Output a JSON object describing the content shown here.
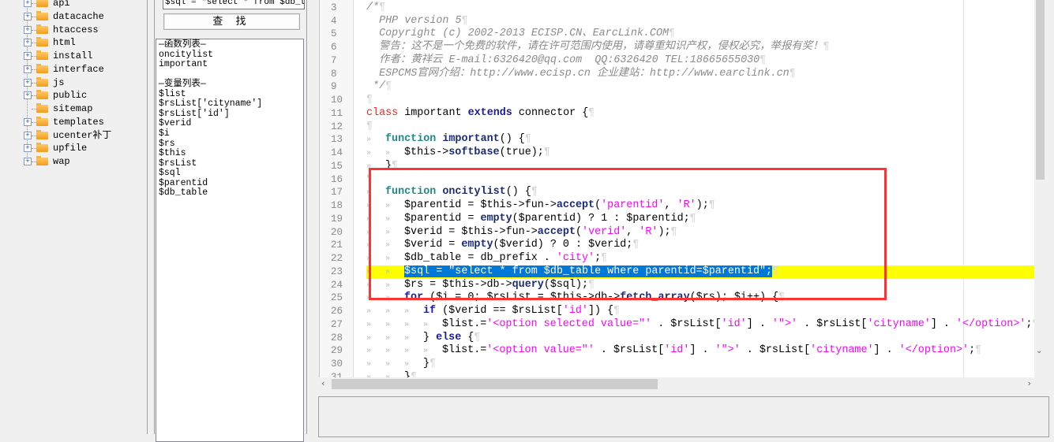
{
  "tree": {
    "items": [
      {
        "label": "api",
        "expandable": true
      },
      {
        "label": "datacache",
        "expandable": true
      },
      {
        "label": "htaccess",
        "expandable": true
      },
      {
        "label": "html",
        "expandable": true
      },
      {
        "label": "install",
        "expandable": true
      },
      {
        "label": "interface",
        "expandable": true
      },
      {
        "label": "js",
        "expandable": true
      },
      {
        "label": "public",
        "expandable": true
      },
      {
        "label": "sitemap",
        "expandable": false
      },
      {
        "label": "templates",
        "expandable": true
      },
      {
        "label": "ucenter补丁",
        "expandable": true
      },
      {
        "label": "upfile",
        "expandable": true
      },
      {
        "label": "wap",
        "expandable": true
      }
    ]
  },
  "search": {
    "value": "$sql = \"select * from $db_ta",
    "button_label": "查 找"
  },
  "symbols": {
    "items": [
      "—函数列表—",
      "oncitylist",
      "important",
      "",
      "—变量列表—",
      "$list",
      "$rsList['cityname']",
      "$rsList['id']",
      "$verid",
      "$i",
      "$rs",
      "$this",
      "$rsList",
      "$sql",
      "$parentid",
      "$db_table"
    ]
  },
  "editor": {
    "current_line": 23,
    "lines": [
      {
        "n": 3,
        "t": [
          [
            "c",
            "/*"
          ],
          [
            "p",
            "¶"
          ]
        ]
      },
      {
        "n": 4,
        "t": [
          [
            "c",
            "  PHP version 5"
          ],
          [
            "p",
            "¶"
          ]
        ]
      },
      {
        "n": 5,
        "t": [
          [
            "c",
            "  Copyright (c) 2002-2013 ECISP.CN、EarcLink.COM"
          ],
          [
            "p",
            "¶"
          ]
        ]
      },
      {
        "n": 6,
        "t": [
          [
            "c",
            "  警告：这不是一个免费的软件，请在许可范围内使用，请尊重知识产权，侵权必究，举报有奖！"
          ],
          [
            "p",
            "¶"
          ]
        ]
      },
      {
        "n": 7,
        "t": [
          [
            "c",
            "  作者：黄祥云 E-mail:6326420@qq.com  QQ:6326420 TEL:18665655030"
          ],
          [
            "p",
            "¶"
          ]
        ]
      },
      {
        "n": 8,
        "t": [
          [
            "c",
            "  ESPCMS官网介绍：http://www.ecisp.cn 企业建站：http://www.earclink.cn"
          ],
          [
            "p",
            "¶"
          ]
        ]
      },
      {
        "n": 9,
        "t": [
          [
            "c",
            " */"
          ],
          [
            "p",
            "¶"
          ]
        ]
      },
      {
        "n": 10,
        "t": [
          [
            "p",
            "¶"
          ]
        ]
      },
      {
        "n": 11,
        "t": [
          [
            "k",
            "class"
          ],
          [
            "v",
            " important "
          ],
          [
            "b",
            "extends"
          ],
          [
            "v",
            " connector {"
          ],
          [
            "p",
            "¶"
          ]
        ]
      },
      {
        "n": 12,
        "t": [
          [
            "p",
            "¶"
          ]
        ]
      },
      {
        "n": 13,
        "t": [
          [
            "t",
            "»   "
          ],
          [
            "f",
            "function"
          ],
          [
            "v",
            " "
          ],
          [
            "n",
            "important"
          ],
          [
            "v",
            "() {"
          ],
          [
            "p",
            "¶"
          ]
        ]
      },
      {
        "n": 14,
        "t": [
          [
            "t",
            "»   »   "
          ],
          [
            "v",
            "$this->"
          ],
          [
            "n",
            "softbase"
          ],
          [
            "v",
            "(true);"
          ],
          [
            "p",
            "¶"
          ]
        ]
      },
      {
        "n": 15,
        "t": [
          [
            "t",
            "»   "
          ],
          [
            "v",
            "}"
          ],
          [
            "p",
            "¶"
          ]
        ]
      },
      {
        "n": 16,
        "t": [
          [
            "p",
            "¶"
          ]
        ]
      },
      {
        "n": 17,
        "t": [
          [
            "t",
            "»   "
          ],
          [
            "f",
            "function"
          ],
          [
            "v",
            " "
          ],
          [
            "n",
            "oncitylist"
          ],
          [
            "v",
            "() {"
          ],
          [
            "p",
            "¶"
          ]
        ]
      },
      {
        "n": 18,
        "t": [
          [
            "t",
            "»   »   "
          ],
          [
            "v",
            "$parentid = $this->fun->"
          ],
          [
            "n",
            "accept"
          ],
          [
            "v",
            "("
          ],
          [
            "s",
            "'parentid'"
          ],
          [
            "v",
            ", "
          ],
          [
            "s",
            "'R'"
          ],
          [
            "v",
            ");"
          ],
          [
            "p",
            "¶"
          ]
        ]
      },
      {
        "n": 19,
        "t": [
          [
            "t",
            "»   »   "
          ],
          [
            "v",
            "$parentid = "
          ],
          [
            "n",
            "empty"
          ],
          [
            "v",
            "($parentid) ? 1 : $parentid;"
          ],
          [
            "p",
            "¶"
          ]
        ]
      },
      {
        "n": 20,
        "t": [
          [
            "t",
            "»   »   "
          ],
          [
            "v",
            "$verid = $this->fun->"
          ],
          [
            "n",
            "accept"
          ],
          [
            "v",
            "("
          ],
          [
            "s",
            "'verid'"
          ],
          [
            "v",
            ", "
          ],
          [
            "s",
            "'R'"
          ],
          [
            "v",
            ");"
          ],
          [
            "p",
            "¶"
          ]
        ]
      },
      {
        "n": 21,
        "t": [
          [
            "t",
            "»   »   "
          ],
          [
            "v",
            "$verid = "
          ],
          [
            "n",
            "empty"
          ],
          [
            "v",
            "($verid) ? 0 : $verid;"
          ],
          [
            "p",
            "¶"
          ]
        ]
      },
      {
        "n": 22,
        "t": [
          [
            "t",
            "»   »   "
          ],
          [
            "v",
            "$db_table = db_prefix . "
          ],
          [
            "s",
            "'city'"
          ],
          [
            "v",
            ";"
          ],
          [
            "p",
            "¶"
          ]
        ]
      },
      {
        "n": 23,
        "t": [
          [
            "t",
            "»   »   "
          ],
          [
            "x",
            "$sql = \"select * from $db_table where parentid=$parentid\";"
          ],
          [
            "p",
            "¶"
          ]
        ]
      },
      {
        "n": 24,
        "t": [
          [
            "t",
            "»   »   "
          ],
          [
            "v",
            "$rs = $this->db->"
          ],
          [
            "n",
            "query"
          ],
          [
            "v",
            "($sql);"
          ],
          [
            "p",
            "¶"
          ]
        ]
      },
      {
        "n": 25,
        "t": [
          [
            "t",
            "»   »   "
          ],
          [
            "b",
            "for"
          ],
          [
            "v",
            " ($i = 0; $rsList = $this->db->"
          ],
          [
            "n",
            "fetch_array"
          ],
          [
            "v",
            "($rs); $i++) {"
          ],
          [
            "p",
            "¶"
          ]
        ]
      },
      {
        "n": 26,
        "t": [
          [
            "t",
            "»   »   »   "
          ],
          [
            "b",
            "if"
          ],
          [
            "v",
            " ($verid == $rsList["
          ],
          [
            "s",
            "'id'"
          ],
          [
            "v",
            "]) {"
          ],
          [
            "p",
            "¶"
          ]
        ]
      },
      {
        "n": 27,
        "t": [
          [
            "t",
            "»   »   »   »   "
          ],
          [
            "v",
            "$list.="
          ],
          [
            "s",
            "'<option selected value=\"'"
          ],
          [
            "v",
            " . $rsList["
          ],
          [
            "s",
            "'id'"
          ],
          [
            "v",
            "] . "
          ],
          [
            "s",
            "'\">'"
          ],
          [
            "v",
            " . $rsList["
          ],
          [
            "s",
            "'cityname'"
          ],
          [
            "v",
            "] . "
          ],
          [
            "s",
            "'</option>'"
          ],
          [
            "v",
            ";"
          ],
          [
            "p",
            "¶"
          ]
        ]
      },
      {
        "n": 28,
        "t": [
          [
            "t",
            "»   »   »   "
          ],
          [
            "v",
            "} "
          ],
          [
            "b",
            "else"
          ],
          [
            "v",
            " {"
          ],
          [
            "p",
            "¶"
          ]
        ]
      },
      {
        "n": 29,
        "t": [
          [
            "t",
            "»   »   »   »   "
          ],
          [
            "v",
            "$list.="
          ],
          [
            "s",
            "'<option value=\"'"
          ],
          [
            "v",
            " . $rsList["
          ],
          [
            "s",
            "'id'"
          ],
          [
            "v",
            "] . "
          ],
          [
            "s",
            "'\">'"
          ],
          [
            "v",
            " . $rsList["
          ],
          [
            "s",
            "'cityname'"
          ],
          [
            "v",
            "] . "
          ],
          [
            "s",
            "'</option>'"
          ],
          [
            "v",
            ";"
          ],
          [
            "p",
            "¶"
          ]
        ]
      },
      {
        "n": 30,
        "t": [
          [
            "t",
            "»   »   »   "
          ],
          [
            "v",
            "}"
          ],
          [
            "p",
            "¶"
          ]
        ]
      },
      {
        "n": 31,
        "t": [
          [
            "t",
            "»   »   "
          ],
          [
            "v",
            "}"
          ],
          [
            "p",
            "¶"
          ]
        ]
      }
    ]
  },
  "colors": {
    "highlight": "#ffff00",
    "selection": "#0078d7",
    "annotation_box": "#ff3333"
  },
  "icons": {
    "expand": "plus-box-icon",
    "folder": "folder-icon",
    "scroll_down": "chevron-down-icon",
    "scroll_right": "chevron-right-icon",
    "scroll_left": "chevron-left-icon"
  }
}
